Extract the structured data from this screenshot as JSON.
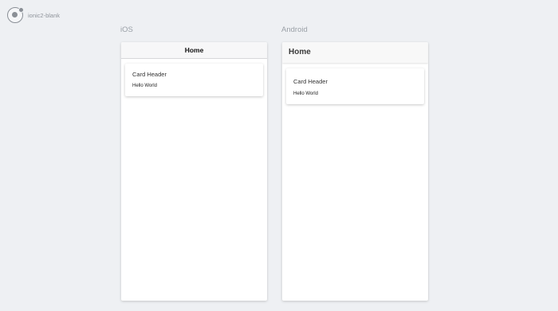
{
  "app": {
    "name": "ionic2-blank"
  },
  "platforms": {
    "ios": {
      "label": "iOS",
      "header_title": "Home",
      "card": {
        "header": "Card Header",
        "content": "Hello World"
      }
    },
    "android": {
      "label": "Android",
      "header_title": "Home",
      "card": {
        "header": "Card Header",
        "content": "Hello World"
      }
    }
  },
  "icons": {
    "logo": "ionic-logo-icon"
  },
  "colors": {
    "background": "#eef0f3",
    "device_bg": "#ffffff",
    "label": "#9aa0a7"
  }
}
